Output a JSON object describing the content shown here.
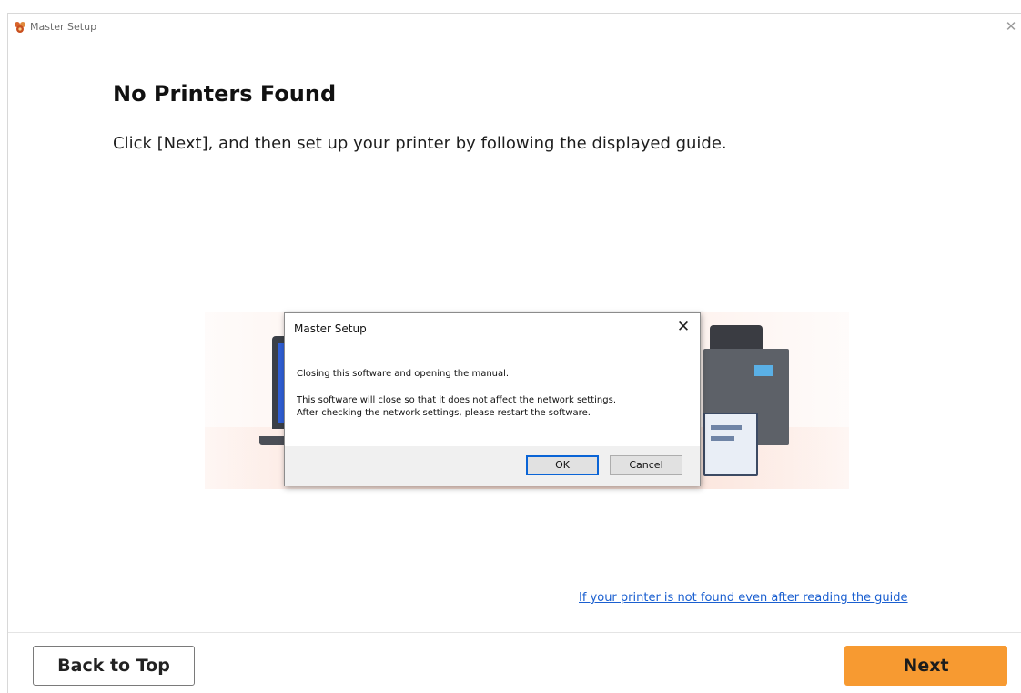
{
  "window": {
    "title": "Master Setup",
    "close_glyph": "✕"
  },
  "main": {
    "heading": "No Printers Found",
    "instruction": "Click [Next], and then set up your printer by following the displayed guide.",
    "help_link": "If your printer is not found even after reading the guide"
  },
  "dialog": {
    "title": "Master Setup",
    "close_glyph": "✕",
    "message_line1": "Closing this software and opening the manual.",
    "message_line2": "This software will close so that it does not affect the network settings.",
    "message_line3": "After checking the network settings, please restart the software.",
    "ok_label": "OK",
    "cancel_label": "Cancel"
  },
  "footer": {
    "back_label": "Back to Top",
    "next_label": "Next"
  },
  "colors": {
    "accent_next": "#f79a31",
    "link": "#1a5fd0",
    "ok_focus_border": "#0a64d6"
  }
}
